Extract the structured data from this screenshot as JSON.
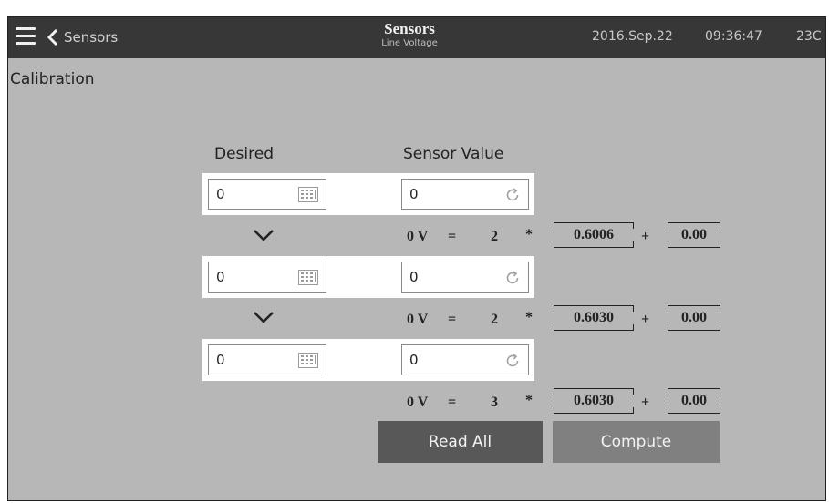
{
  "topbar": {
    "back_label": "Sensors",
    "title": "Sensors",
    "subtitle": "Line Voltage",
    "date": "2016.Sep.22",
    "time": "09:36:47",
    "temperature": "23C"
  },
  "section_title": "Calibration",
  "columns": {
    "desired": "Desired",
    "sensor_value": "Sensor Value"
  },
  "rows": [
    {
      "desired": "0",
      "sensor_value": "0",
      "lhs": "0 V",
      "eq": "=",
      "count": "2",
      "mul": "*",
      "gain": "0.6006",
      "plus": "+",
      "offset": "0.00"
    },
    {
      "desired": "0",
      "sensor_value": "0",
      "lhs": "0 V",
      "eq": "=",
      "count": "2",
      "mul": "*",
      "gain": "0.6030",
      "plus": "+",
      "offset": "0.00"
    },
    {
      "desired": "0",
      "sensor_value": "0",
      "lhs": "0 V",
      "eq": "=",
      "count": "3",
      "mul": "*",
      "gain": "0.6030",
      "plus": "+",
      "offset": "0.00"
    }
  ],
  "buttons": {
    "read_all": "Read All",
    "compute": "Compute"
  },
  "colors": {
    "topbar": "#373737",
    "background": "#b7b7b7",
    "read_all": "#585858",
    "compute": "#808080"
  },
  "icons": {
    "menu": "hamburger-icon",
    "back": "chevron-left-icon",
    "calculator": "calculator-icon",
    "refresh": "refresh-icon",
    "down": "chevron-down-icon"
  }
}
